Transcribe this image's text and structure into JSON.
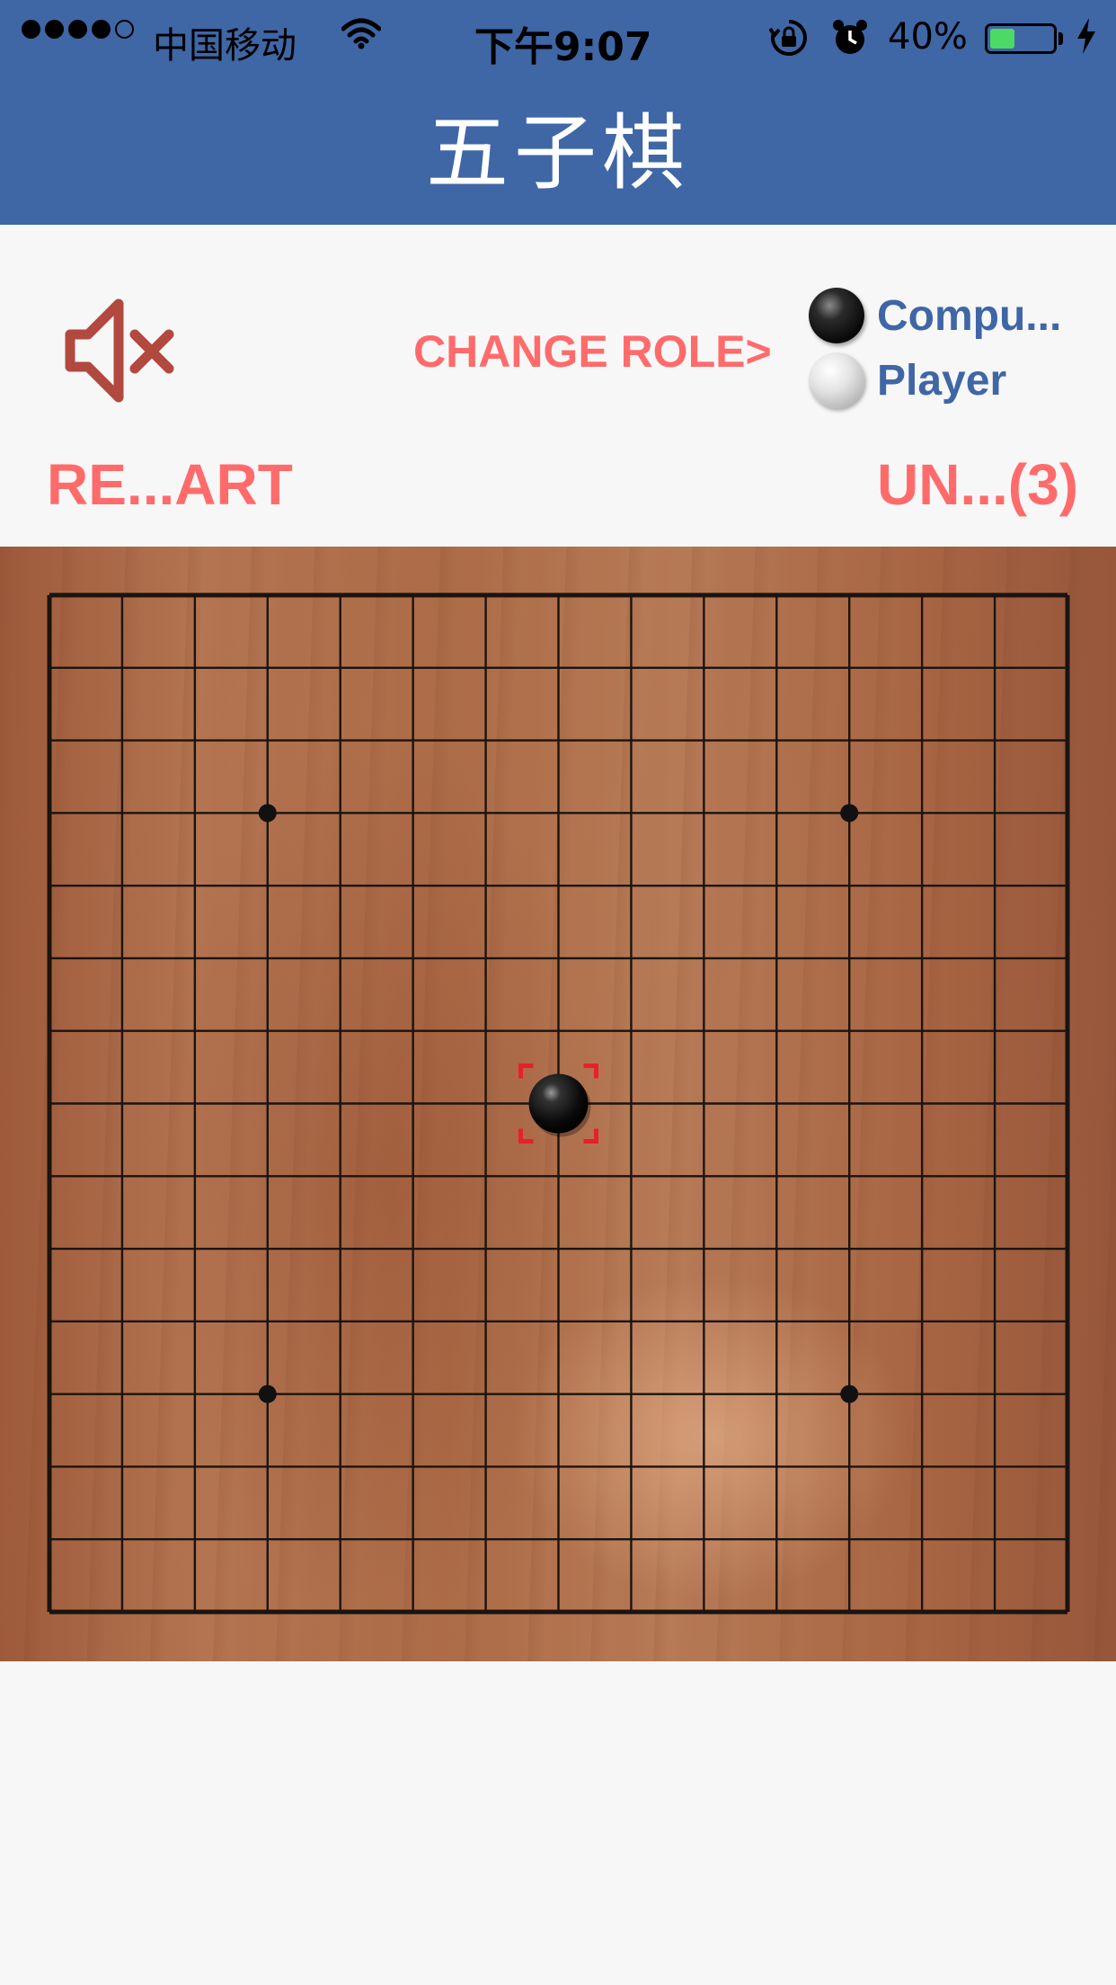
{
  "status_bar": {
    "carrier": "中国移动",
    "time": "下午9:07",
    "battery_percent": "40%",
    "battery_level": 0.4,
    "signal_dots_filled": 4,
    "signal_dots_total": 5
  },
  "header": {
    "title": "五子棋",
    "background_color": "#3f66a5"
  },
  "controls": {
    "mute_icon": "speaker-muted-icon",
    "change_role_label": "CHANGE ROLE>",
    "roles": [
      {
        "stone": "black",
        "label": "Compu..."
      },
      {
        "stone": "white",
        "label": "Player"
      }
    ],
    "restart_label": "RE...ART",
    "undo_label": "UN...(3)",
    "accent_color": "#ff6b6b",
    "role_color": "#3f66a5"
  },
  "board": {
    "size": 15,
    "star_points": [
      [
        3,
        3
      ],
      [
        11,
        3
      ],
      [
        3,
        11
      ],
      [
        11,
        11
      ]
    ],
    "stones": [
      {
        "col": 7,
        "row": 7,
        "color": "black",
        "last_move": true
      }
    ],
    "last_move_marker_color": "#e8202a"
  }
}
